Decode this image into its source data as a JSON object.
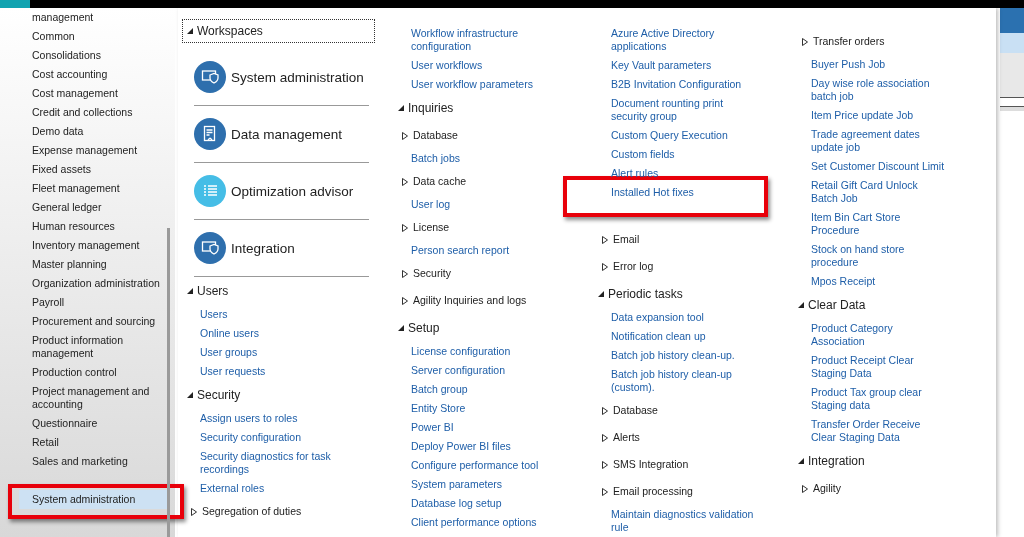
{
  "sidebar": {
    "items": [
      {
        "label": "management",
        "selected": false,
        "highlighted": false
      },
      {
        "label": "Common",
        "selected": false,
        "highlighted": false
      },
      {
        "label": "Consolidations",
        "selected": false,
        "highlighted": false
      },
      {
        "label": "Cost accounting",
        "selected": false,
        "highlighted": false
      },
      {
        "label": "Cost management",
        "selected": false,
        "highlighted": false
      },
      {
        "label": "Credit and collections",
        "selected": false,
        "highlighted": false
      },
      {
        "label": "Demo data",
        "selected": false,
        "highlighted": false
      },
      {
        "label": "Expense management",
        "selected": false,
        "highlighted": false
      },
      {
        "label": "Fixed assets",
        "selected": false,
        "highlighted": false
      },
      {
        "label": "Fleet management",
        "selected": false,
        "highlighted": false
      },
      {
        "label": "General ledger",
        "selected": false,
        "highlighted": false
      },
      {
        "label": "Human resources",
        "selected": false,
        "highlighted": false
      },
      {
        "label": "Inventory management",
        "selected": false,
        "highlighted": false
      },
      {
        "label": "Master planning",
        "selected": false,
        "highlighted": false
      },
      {
        "label": "Organization administration",
        "selected": false,
        "highlighted": false
      },
      {
        "label": "Payroll",
        "selected": false,
        "highlighted": false
      },
      {
        "label": "Procurement and sourcing",
        "selected": false,
        "highlighted": false
      },
      {
        "label": "Product information management",
        "selected": false,
        "highlighted": false
      },
      {
        "label": "Production control",
        "selected": false,
        "highlighted": false
      },
      {
        "label": "Project management and accounting",
        "selected": false,
        "highlighted": false
      },
      {
        "label": "Questionnaire",
        "selected": false,
        "highlighted": false
      },
      {
        "label": "Retail",
        "selected": false,
        "highlighted": false
      },
      {
        "label": "Sales and marketing",
        "selected": false,
        "highlighted": false
      },
      {
        "label": "System administration",
        "selected": true,
        "highlighted": true
      }
    ]
  },
  "columns": [
    [
      {
        "kind": "header",
        "label": "Workspaces",
        "expanded": true,
        "focused": true
      },
      {
        "kind": "tile",
        "label": "System administration",
        "color": "#2e6fad"
      },
      {
        "kind": "tile",
        "label": "Data management",
        "color": "#2e6fad"
      },
      {
        "kind": "tile",
        "label": "Optimization advisor",
        "color": "#45bde6"
      },
      {
        "kind": "tile",
        "label": "Integration",
        "color": "#2e6fad"
      },
      {
        "kind": "header",
        "label": "Users",
        "expanded": true,
        "focused": false
      },
      {
        "kind": "link",
        "label": "Users",
        "highlighted": false
      },
      {
        "kind": "link",
        "label": "Online users",
        "highlighted": false
      },
      {
        "kind": "link",
        "label": "User groups",
        "highlighted": false
      },
      {
        "kind": "link",
        "label": "User requests",
        "highlighted": false
      },
      {
        "kind": "header",
        "label": "Security",
        "expanded": true,
        "focused": false
      },
      {
        "kind": "link",
        "label": "Assign users to roles",
        "highlighted": false
      },
      {
        "kind": "link",
        "label": "Security configuration",
        "highlighted": false
      },
      {
        "kind": "link",
        "label": "Security diagnostics for task recordings",
        "highlighted": false
      },
      {
        "kind": "link",
        "label": "External roles",
        "highlighted": false
      },
      {
        "kind": "group",
        "label": "Segregation of duties",
        "expanded": false
      }
    ],
    [
      {
        "kind": "link",
        "label": "Workflow infrastructure configuration",
        "highlighted": false
      },
      {
        "kind": "link",
        "label": "User workflows",
        "highlighted": false
      },
      {
        "kind": "link",
        "label": "User workflow parameters",
        "highlighted": false
      },
      {
        "kind": "header",
        "label": "Inquiries",
        "expanded": true,
        "focused": false
      },
      {
        "kind": "group",
        "label": "Database",
        "expanded": false
      },
      {
        "kind": "link",
        "label": "Batch jobs",
        "highlighted": false
      },
      {
        "kind": "group",
        "label": "Data cache",
        "expanded": false
      },
      {
        "kind": "link",
        "label": "User log",
        "highlighted": false
      },
      {
        "kind": "group",
        "label": "License",
        "expanded": false
      },
      {
        "kind": "link",
        "label": "Person search report",
        "highlighted": false
      },
      {
        "kind": "group",
        "label": "Security",
        "expanded": false
      },
      {
        "kind": "group",
        "label": "Agility Inquiries and logs",
        "expanded": false
      },
      {
        "kind": "header",
        "label": "Setup",
        "expanded": true,
        "focused": false
      },
      {
        "kind": "link",
        "label": "License configuration",
        "highlighted": false
      },
      {
        "kind": "link",
        "label": "Server configuration",
        "highlighted": false
      },
      {
        "kind": "link",
        "label": "Batch group",
        "highlighted": false
      },
      {
        "kind": "link",
        "label": "Entity Store",
        "highlighted": false
      },
      {
        "kind": "link",
        "label": "Power BI",
        "highlighted": false
      },
      {
        "kind": "link",
        "label": "Deploy Power BI files",
        "highlighted": false
      },
      {
        "kind": "link",
        "label": "Configure performance tool",
        "highlighted": false
      },
      {
        "kind": "link",
        "label": "System parameters",
        "highlighted": false
      },
      {
        "kind": "link",
        "label": "Database log setup",
        "highlighted": false
      },
      {
        "kind": "link",
        "label": "Client performance options",
        "highlighted": false
      }
    ],
    [
      {
        "kind": "link",
        "label": "Azure Active Directory applications",
        "highlighted": false
      },
      {
        "kind": "link",
        "label": "Key Vault parameters",
        "highlighted": false
      },
      {
        "kind": "link",
        "label": "B2B Invitation Configuration",
        "highlighted": false
      },
      {
        "kind": "link",
        "label": "Document rounting print security group",
        "highlighted": false
      },
      {
        "kind": "link",
        "label": "Custom Query Execution",
        "highlighted": false
      },
      {
        "kind": "link",
        "label": "Custom fields",
        "highlighted": false
      },
      {
        "kind": "link",
        "label": "Alert rules",
        "highlighted": false
      },
      {
        "kind": "link",
        "label": "Installed Hot fixes",
        "highlighted": true
      },
      {
        "kind": "group",
        "label": "Email",
        "expanded": false
      },
      {
        "kind": "group",
        "label": "Error log",
        "expanded": false
      },
      {
        "kind": "header",
        "label": "Periodic tasks",
        "expanded": true,
        "focused": false
      },
      {
        "kind": "link",
        "label": "Data expansion tool",
        "highlighted": false
      },
      {
        "kind": "link",
        "label": "Notification clean up",
        "highlighted": false
      },
      {
        "kind": "link",
        "label": "Batch job history clean-up.",
        "highlighted": false
      },
      {
        "kind": "link",
        "label": "Batch job history clean-up (custom).",
        "highlighted": false
      },
      {
        "kind": "group",
        "label": "Database",
        "expanded": false
      },
      {
        "kind": "group",
        "label": "Alerts",
        "expanded": false
      },
      {
        "kind": "group",
        "label": "SMS Integration",
        "expanded": false
      },
      {
        "kind": "group",
        "label": "Email processing",
        "expanded": false
      },
      {
        "kind": "link",
        "label": "Maintain diagnostics validation rule",
        "highlighted": false
      }
    ],
    [
      {
        "kind": "group",
        "label": "Transfer orders",
        "expanded": false
      },
      {
        "kind": "link",
        "label": "Buyer Push Job",
        "highlighted": false
      },
      {
        "kind": "link",
        "label": "Day wise role association batch job",
        "highlighted": false
      },
      {
        "kind": "link",
        "label": "Item Price update Job",
        "highlighted": false
      },
      {
        "kind": "link",
        "label": "Trade agreement dates update job",
        "highlighted": false
      },
      {
        "kind": "link",
        "label": "Set Customer Discount Limit",
        "highlighted": false
      },
      {
        "kind": "link",
        "label": "Retail Gift Card Unlock Batch Job",
        "highlighted": false
      },
      {
        "kind": "link",
        "label": "Item Bin Cart Store Procedure",
        "highlighted": false
      },
      {
        "kind": "link",
        "label": "Stock on hand store procedure",
        "highlighted": false
      },
      {
        "kind": "link",
        "label": "Mpos Receipt",
        "highlighted": false
      },
      {
        "kind": "header",
        "label": "Clear Data",
        "expanded": true,
        "focused": false
      },
      {
        "kind": "link",
        "label": "Product Category Association",
        "highlighted": false
      },
      {
        "kind": "link",
        "label": "Product Receipt Clear Staging Data",
        "highlighted": false
      },
      {
        "kind": "link",
        "label": "Product Tax group clear Staging data",
        "highlighted": false
      },
      {
        "kind": "link",
        "label": "Transfer Order Receive Clear Staging Data",
        "highlighted": false
      },
      {
        "kind": "header",
        "label": "Integration",
        "expanded": true,
        "focused": false
      },
      {
        "kind": "group",
        "label": "Agility",
        "expanded": false
      }
    ]
  ]
}
